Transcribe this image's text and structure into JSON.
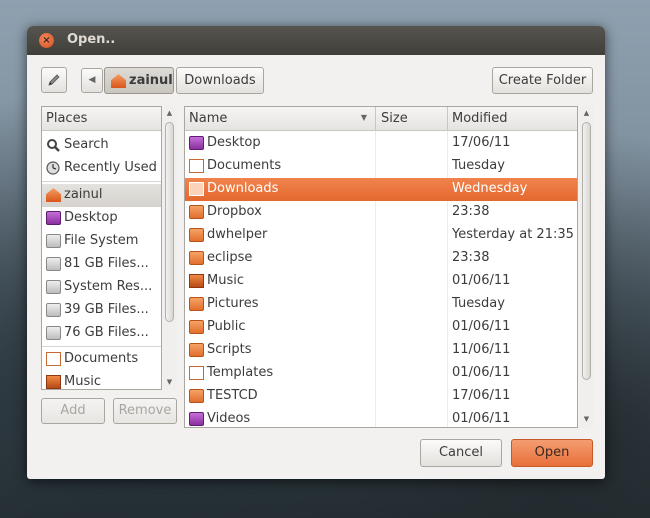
{
  "dialog": {
    "title": "Open.."
  },
  "pathbar": {
    "home_label": "zainul",
    "current_label": "Downloads",
    "create_folder_label": "Create Folder"
  },
  "places": {
    "header": "Places",
    "items": [
      {
        "label": "Search",
        "icon": "search-icon"
      },
      {
        "label": "Recently Used",
        "icon": "clock-icon"
      },
      {
        "label": "zainul",
        "icon": "home-icon"
      },
      {
        "label": "Desktop",
        "icon": "desktop-icon"
      },
      {
        "label": "File System",
        "icon": "drive-icon"
      },
      {
        "label": "81 GB Files...",
        "icon": "drive-icon"
      },
      {
        "label": "System Res...",
        "icon": "drive-icon"
      },
      {
        "label": "39 GB Files...",
        "icon": "usb-drive-icon"
      },
      {
        "label": "76 GB Files...",
        "icon": "usb-drive-icon"
      },
      {
        "label": "Documents",
        "icon": "documents-folder-icon"
      },
      {
        "label": "Music",
        "icon": "music-folder-icon"
      }
    ],
    "add_label": "Add",
    "remove_label": "Remove"
  },
  "files": {
    "columns": {
      "name": "Name",
      "size": "Size",
      "modified": "Modified"
    },
    "rows": [
      {
        "name": "Desktop",
        "size": "",
        "modified": "17/06/11",
        "icon": "desktop-icon"
      },
      {
        "name": "Documents",
        "size": "",
        "modified": "Tuesday",
        "icon": "documents-folder-icon"
      },
      {
        "name": "Downloads",
        "size": "",
        "modified": "Wednesday",
        "icon": "downloads-folder-icon",
        "selected": true
      },
      {
        "name": "Dropbox",
        "size": "",
        "modified": "23:38",
        "icon": "folder-icon"
      },
      {
        "name": "dwhelper",
        "size": "",
        "modified": "Yesterday at 21:35",
        "icon": "folder-icon"
      },
      {
        "name": "eclipse",
        "size": "",
        "modified": "23:38",
        "icon": "folder-icon"
      },
      {
        "name": "Music",
        "size": "",
        "modified": "01/06/11",
        "icon": "music-folder-icon"
      },
      {
        "name": "Pictures",
        "size": "",
        "modified": "Tuesday",
        "icon": "pictures-folder-icon"
      },
      {
        "name": "Public",
        "size": "",
        "modified": "01/06/11",
        "icon": "public-folder-icon"
      },
      {
        "name": "Scripts",
        "size": "",
        "modified": "11/06/11",
        "icon": "folder-icon"
      },
      {
        "name": "Templates",
        "size": "",
        "modified": "01/06/11",
        "icon": "templates-folder-icon"
      },
      {
        "name": "TESTCD",
        "size": "",
        "modified": "17/06/11",
        "icon": "folder-icon"
      },
      {
        "name": "Videos",
        "size": "",
        "modified": "01/06/11",
        "icon": "videos-folder-icon"
      }
    ]
  },
  "actions": {
    "cancel_label": "Cancel",
    "open_label": "Open"
  },
  "colors": {
    "accent": "#e9723a",
    "titlebar": "#403f3a"
  }
}
